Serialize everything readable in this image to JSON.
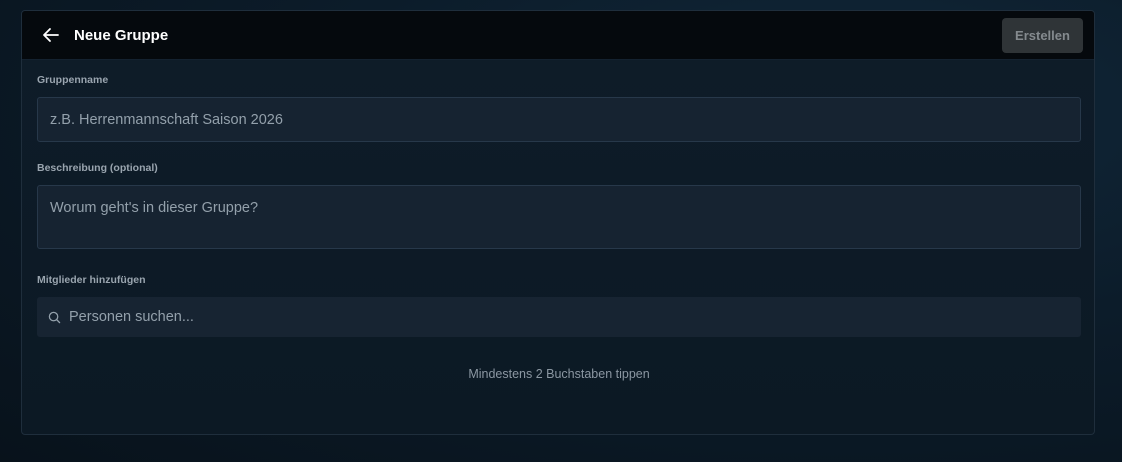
{
  "header": {
    "title": "Neue Gruppe",
    "back_icon": "arrow-left-icon",
    "create_label": "Erstellen"
  },
  "form": {
    "name_label": "Gruppenname",
    "name_placeholder": "z.B. Herrenmannschaft Saison 2026",
    "description_label": "Beschreibung (optional)",
    "description_placeholder": "Worum geht's in dieser Gruppe?",
    "members_label": "Mitglieder hinzufügen",
    "search_placeholder": "Personen suchen...",
    "search_icon": "search-icon",
    "hint": "Mindestens 2 Buchstaben tippen"
  },
  "colors": {
    "background": "#0c1c2a",
    "panel": "#0e1c29",
    "header": "#05090d",
    "field": "#162331",
    "button_disabled": "#2f3437"
  }
}
